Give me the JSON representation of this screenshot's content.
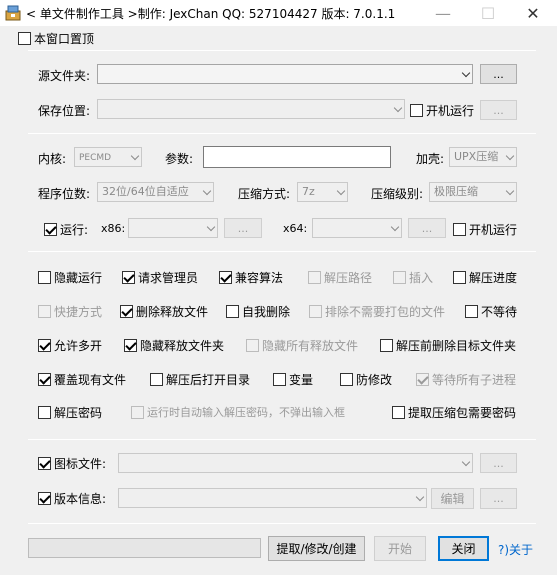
{
  "window": {
    "title": "< 单文件制作工具 >制作: JexChan  QQ: 527104427  版本: 7.0.1.1",
    "minimize": "—",
    "maximize": "☐",
    "close": "✕"
  },
  "top": {
    "stay_on_top": {
      "label": "本窗口置顶",
      "checked": false
    }
  },
  "source": {
    "source_folder_label": "源文件夹:",
    "source_folder_value": "",
    "browse_source": "...",
    "save_location_label": "保存位置:",
    "save_location_value": "",
    "autorun_label": "开机运行",
    "browse_save": "..."
  },
  "options": {
    "kernel_label": "内核:",
    "kernel_value": "PECMD",
    "params_label": "参数:",
    "params_value": "",
    "shell_label": "加壳:",
    "shell_value": "UPX压缩",
    "bitness_label": "程序位数:",
    "bitness_value": "32位/64位自适应",
    "compress_label": "压缩方式:",
    "compress_value": "7z",
    "level_label": "压缩级别:",
    "level_value": "极限压缩",
    "run_label": "运行:",
    "x86_label": "x86:",
    "x86_value": "",
    "x86_browse": "...",
    "x64_label": "x64:",
    "x64_value": "",
    "x64_browse": "...",
    "autorun2_label": "开机运行"
  },
  "checks": {
    "hide_run": {
      "label": "隐藏运行",
      "checked": false
    },
    "request_admin": {
      "label": "请求管理员",
      "checked": true
    },
    "compat_algo": {
      "label": "兼容算法",
      "checked": true
    },
    "extract_path": {
      "label": "解压路径",
      "checked": false
    },
    "insert": {
      "label": "插入",
      "checked": false
    },
    "extract_progress": {
      "label": "解压进度",
      "checked": false
    },
    "shortcut": {
      "label": "快捷方式",
      "checked": false
    },
    "delete_released": {
      "label": "删除释放文件",
      "checked": true
    },
    "self_delete": {
      "label": "自我删除",
      "checked": false
    },
    "exclude_unneeded": {
      "label": "排除不需要打包的文件",
      "checked": false
    },
    "no_wait": {
      "label": "不等待",
      "checked": false
    },
    "allow_multi": {
      "label": "允许多开",
      "checked": true
    },
    "hide_released": {
      "label": "隐藏释放文件夹",
      "checked": true
    },
    "hide_all_released": {
      "label": "隐藏所有释放文件",
      "checked": false
    },
    "delete_target_before": {
      "label": "解压前删除目标文件夹",
      "checked": false
    },
    "overwrite_existing": {
      "label": "覆盖现有文件",
      "checked": true
    },
    "open_dir_after": {
      "label": "解压后打开目录",
      "checked": false
    },
    "variables": {
      "label": "变量",
      "checked": false
    },
    "tamper_proof": {
      "label": "防修改",
      "checked": false
    },
    "wait_children": {
      "label": "等待所有子进程",
      "checked": true
    },
    "extract_password": {
      "label": "解压密码",
      "checked": false
    },
    "auto_input_password": {
      "label": "运行时自动输入解压密码，不弹出输入框",
      "checked": false
    },
    "require_password_extract": {
      "label": "提取压缩包需要密码",
      "checked": false
    }
  },
  "resources": {
    "icon_file": {
      "label": "图标文件:",
      "checked": true,
      "value": "",
      "browse": "..."
    },
    "version_info": {
      "label": "版本信息:",
      "checked": true,
      "value": "",
      "edit": "编辑",
      "browse": "..."
    }
  },
  "footer": {
    "progress": 0,
    "extract_btn": "提取/修改/创建",
    "start_btn": "开始",
    "close_btn": "关闭",
    "about_link": "?)关于"
  }
}
